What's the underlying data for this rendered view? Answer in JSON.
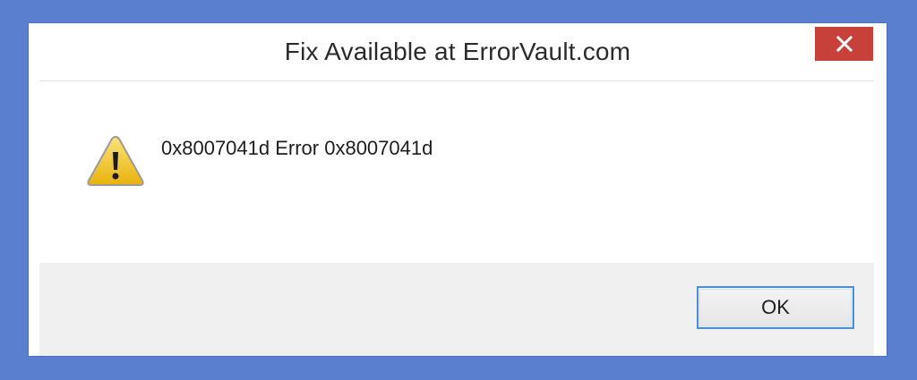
{
  "dialog": {
    "title": "Fix Available at ErrorVault.com",
    "message": "0x8007041d Error 0x8007041d",
    "ok_label": "OK",
    "close_icon": "close-icon",
    "status_icon": "warning-icon"
  },
  "colors": {
    "desktop_background": "#5b7fcf",
    "close_button": "#c7403a",
    "footer_background": "#f0f0f0",
    "ok_border": "#4b8fd6",
    "warning_fill": "#f2c417"
  }
}
